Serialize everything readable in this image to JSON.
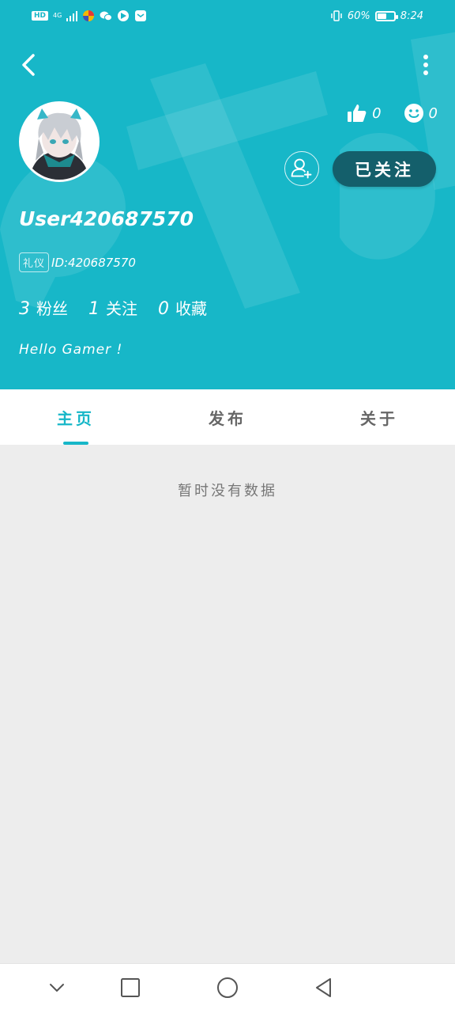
{
  "status_bar": {
    "network_badge": "HD",
    "network_type": "4G",
    "battery_percent": "60%",
    "battery_level": 0.6,
    "time": "8:24"
  },
  "profile": {
    "username": "User420687570",
    "badge": "礼仪",
    "id_text": "ID:420687570",
    "likes": "0",
    "smiles": "0",
    "follow_label": "已关注",
    "fans_count": "3",
    "fans_label": "粉丝",
    "following_count": "1",
    "following_label": "关注",
    "favorites_count": "0",
    "favorites_label": "收藏",
    "bio": "Hello Gamer !"
  },
  "tabs": [
    {
      "label": "主页",
      "active": true
    },
    {
      "label": "发布",
      "active": false
    },
    {
      "label": "关于",
      "active": false
    }
  ],
  "content": {
    "empty_message": "暂时没有数据"
  },
  "icons": {
    "back": "chevron-left-icon",
    "more": "more-vertical-icon",
    "like": "thumbs-up-icon",
    "smile": "smile-icon",
    "add_friend": "add-user-icon",
    "nav_down": "chevron-down-icon",
    "nav_recent": "square-icon",
    "nav_home": "circle-icon",
    "nav_back": "triangle-back-icon"
  },
  "colors": {
    "header_bg": "#17b7c8",
    "follow_button_bg": "#145f6b",
    "accent": "#17b7c8",
    "content_bg": "#ededed"
  }
}
